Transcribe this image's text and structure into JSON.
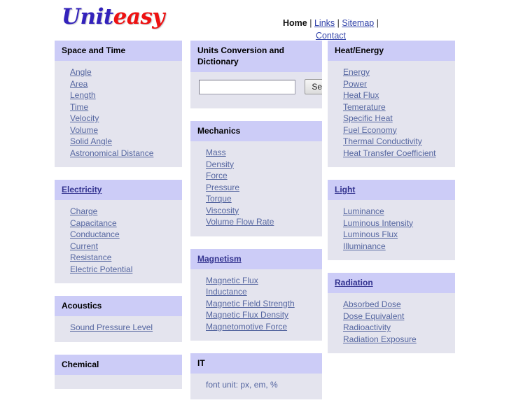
{
  "site": {
    "logo_part_a": "Unit",
    "logo_part_b": "easy"
  },
  "nav": {
    "home": "Home",
    "links": "Links",
    "sitemap": "Sitemap",
    "contact": "Contact",
    "separator": "|"
  },
  "search": {
    "title": "Units Conversion and Dictionary",
    "value": "",
    "placeholder": "",
    "button_label": "Search"
  },
  "colors": {
    "panel_header_bg": "#ccccf7",
    "panel_body_bg": "#e4e4ee",
    "link": "#5566a0",
    "logo_blue": "#3322bb",
    "logo_red": "#ee1111"
  },
  "columns": {
    "left": [
      {
        "title": "Space and Time",
        "title_is_link": false,
        "items": [
          "Angle",
          "Area",
          "Length",
          "Time",
          "Velocity",
          "Volume",
          "Solid Angle",
          "Astronomical Distance"
        ]
      },
      {
        "title": "Electricity",
        "title_is_link": true,
        "items": [
          "Charge",
          "Capacitance",
          "Conductance",
          "Current",
          "Resistance",
          "Electric Potential"
        ]
      },
      {
        "title": "Acoustics",
        "title_is_link": false,
        "items": [
          "Sound Pressure Level"
        ]
      },
      {
        "title": "Chemical",
        "title_is_link": false,
        "items": []
      }
    ],
    "middle": [
      {
        "title": "Mechanics",
        "title_is_link": false,
        "items": [
          "Mass",
          "Density",
          "Force",
          "Pressure",
          "Torque",
          "Viscosity",
          "Volume Flow Rate"
        ]
      },
      {
        "title": "Magnetism",
        "title_is_link": true,
        "items": [
          "Magnetic Flux",
          "Inductance",
          "Magnetic Field Strength",
          "Magnetic Flux Density",
          "Magnetomotive Force"
        ]
      },
      {
        "title": "IT",
        "title_is_link": false,
        "items": [
          "font unit: px, em, %"
        ]
      }
    ],
    "right": [
      {
        "title": "Heat/Energy",
        "title_is_link": false,
        "items": [
          "Energy",
          "Power",
          "Heat Flux",
          "Temerature",
          "Specific Heat",
          "Fuel Economy",
          "Thermal Conductivity",
          "Heat Transfer Coefficient"
        ]
      },
      {
        "title": "Light",
        "title_is_link": true,
        "items": [
          "Luminance",
          "Luminous Intensity",
          "Luminous Flux",
          "Illuminance"
        ]
      },
      {
        "title": "Radiation",
        "title_is_link": true,
        "items": [
          "Absorbed Dose",
          "Dose Equivalent",
          "Radioactivity",
          "Radiation Exposure"
        ]
      }
    ]
  }
}
